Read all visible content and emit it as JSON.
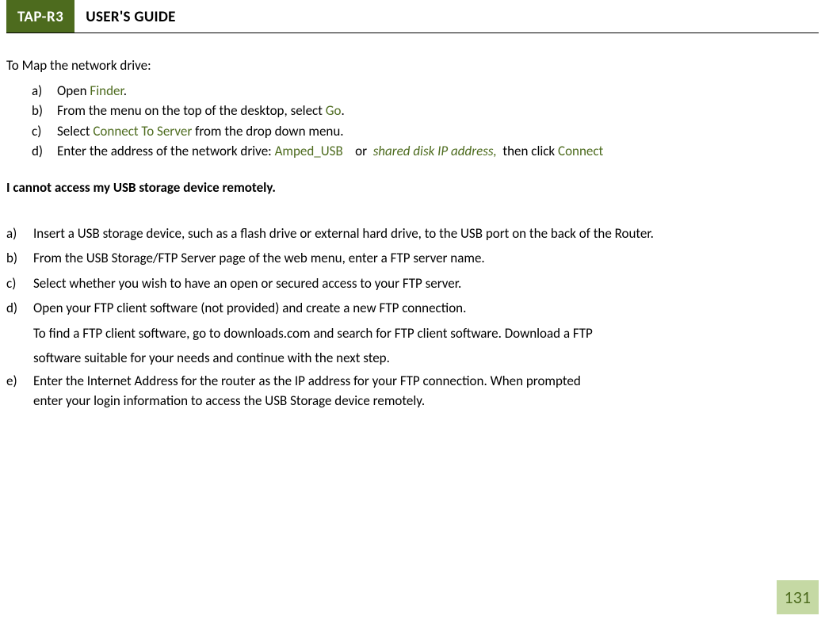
{
  "header": {
    "badge": "TAP-R3",
    "title": "USER'S GUIDE"
  },
  "intro": "To Map the network drive:",
  "list1": {
    "a_marker": "a)",
    "a_prefix": "Open ",
    "a_finder": "Finder",
    "a_suffix": ".",
    "b_marker": "b)",
    "b_prefix": "From the menu on the top of the desktop, select ",
    "b_go": "Go",
    "b_suffix": ".",
    "c_marker": "c)",
    "c_prefix": "Select ",
    "c_connect": "Connect To Server",
    "c_suffix": " from the drop down menu.",
    "d_marker": "d)",
    "d_prefix": "Enter the address of the network drive: ",
    "d_amped": "Amped_USB",
    "d_or": "    or  ",
    "d_shared": "shared disk IP address,",
    "d_then": "  then click ",
    "d_connect": "Connect"
  },
  "subheading": "I cannot access my USB storage device remotely.",
  "list2": {
    "a_marker": "a)",
    "a_text": "Insert a USB storage device, such as a flash drive or external hard drive, to the USB port on the back of the Router.",
    "b_marker": "b)",
    "b_text": "From the USB Storage/FTP Server page of the web menu, enter a FTP server name.",
    "c_marker": "c)",
    "c_text": "Select whether you wish to have an open or secured access to your FTP server.",
    "d_marker": "d)",
    "d_text": "Open your FTP client software (not provided) and create a new FTP connection.",
    "d_sub1": "To find a FTP client software, go to downloads.com and search for FTP client software.  Download a FTP",
    "d_sub2": "software suitable for your needs and continue with the next step.",
    "e_marker": "e)",
    "e_text1": "Enter the Internet Address for the router as the IP address for your FTP connection.  When prompted",
    "e_text2": "enter your login information to access the USB Storage device remotely."
  },
  "page_number": "131"
}
